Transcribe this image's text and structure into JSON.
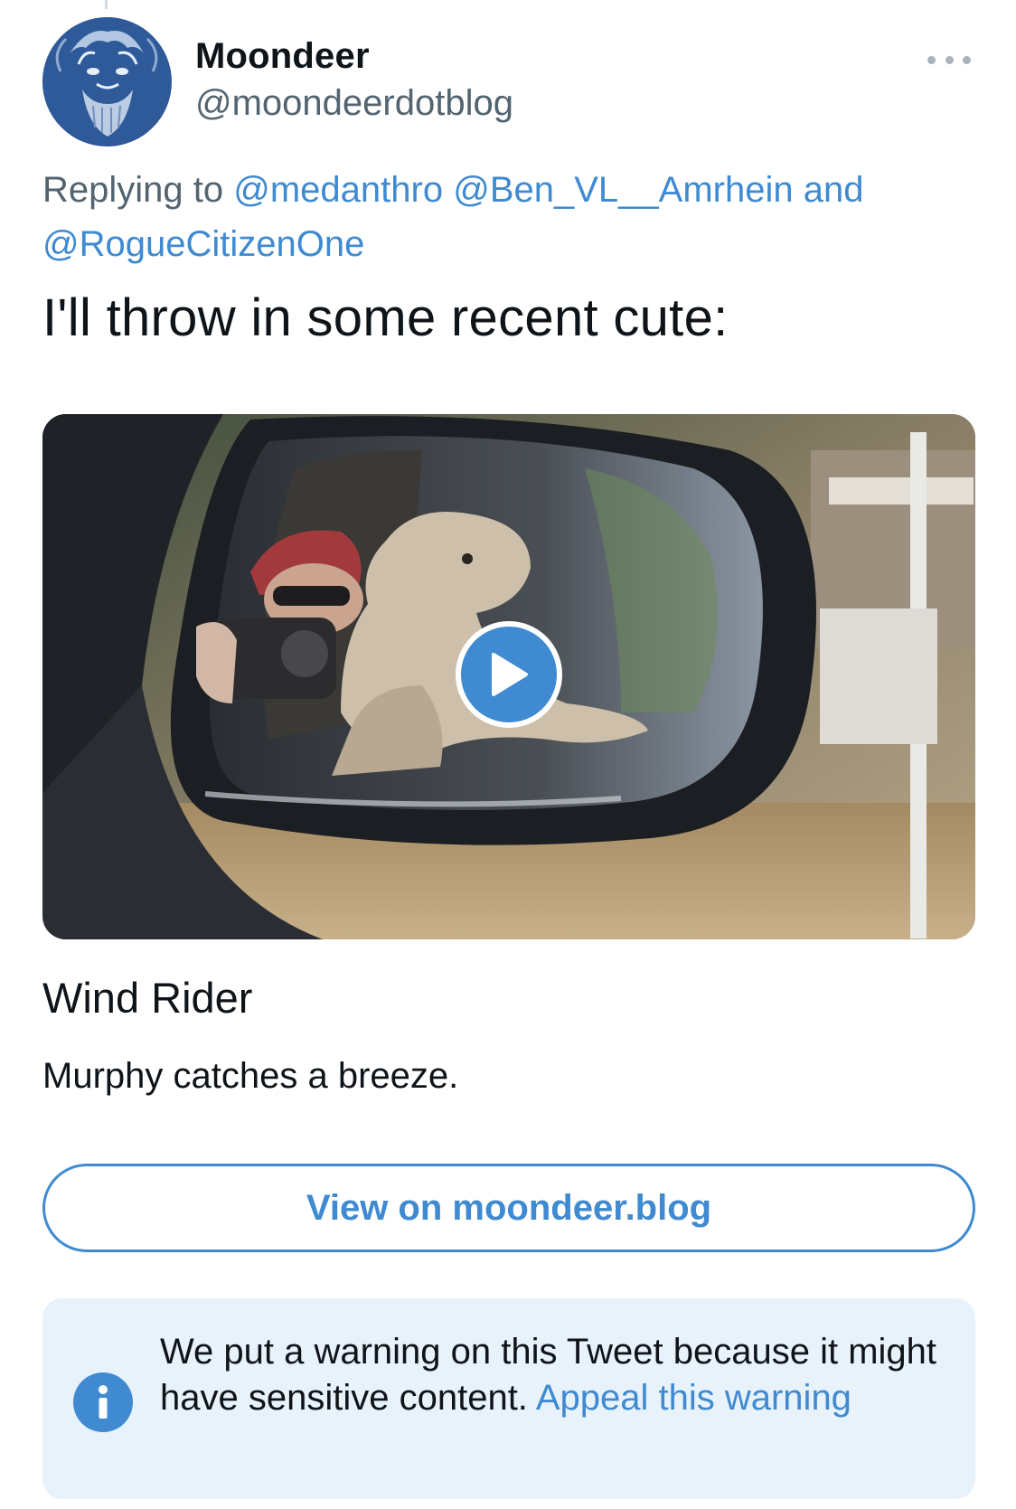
{
  "author": {
    "display_name": "Moondeer",
    "handle": "@moondeerdotblog",
    "avatar_icon": "bearded-face-avatar"
  },
  "more_icon": "more-horizontal-icon",
  "reply_context": {
    "prefix": "Replying to",
    "mentions": [
      "@medanthro",
      "@Ben_VL__Amrhein",
      "@RogueCitizenOne"
    ],
    "conjunction": "and"
  },
  "tweet": {
    "text": "I'll throw in some recent cute:"
  },
  "media": {
    "type": "video",
    "play_icon": "play-icon"
  },
  "card": {
    "title": "Wind Rider",
    "description": "Murphy catches a breeze.",
    "view_button_label": "View on moondeer.blog"
  },
  "warning": {
    "icon": "info-icon",
    "text": "We put a warning on this Tweet because it might have sensitive content.",
    "appeal_label": "Appeal this warning"
  },
  "colors": {
    "link": "#3f8ad0",
    "secondary_text": "#536471",
    "warning_background": "#e8f2fb"
  }
}
